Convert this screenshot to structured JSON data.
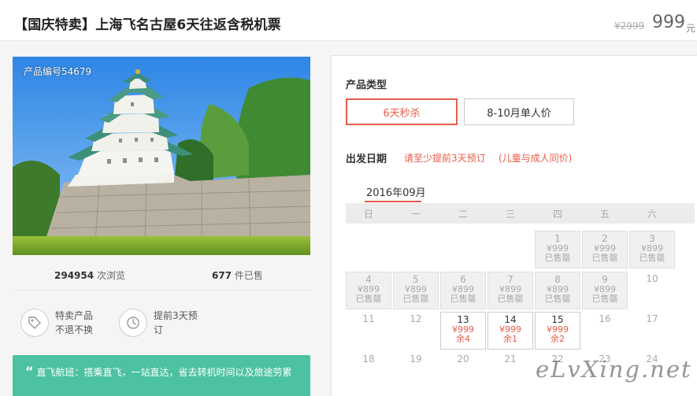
{
  "header": {
    "title": "【国庆特卖】上海飞名古屋6天往返含税机票",
    "old_price": "¥2999",
    "price": "999",
    "unit": "元"
  },
  "photo": {
    "product_no": "产品编号54679",
    "alt": "nagoya-castle-photo"
  },
  "stats": {
    "views_num": "294954",
    "views_label": "次浏览",
    "sold_num": "677",
    "sold_label": "件已售"
  },
  "features": [
    {
      "icon": "tag-icon",
      "line1": "特卖产品",
      "line2": "不退不换"
    },
    {
      "icon": "clock-icon",
      "line1": "提前3天预",
      "line2": "订"
    }
  ],
  "notice": {
    "quote": "“",
    "text": "直飞航班：搭乘直飞，一站直达，省去转机时间以及旅途劳累"
  },
  "booking": {
    "type_label": "产品类型",
    "types": [
      "6天秒杀",
      "8-10月单人价"
    ],
    "active_type": 0,
    "date_label": "出发日期",
    "note1": "请至少提前3天预订",
    "note2": "(儿童与成人同价)",
    "month": "2016年09月",
    "weekdays": [
      "日",
      "一",
      "二",
      "三",
      "四",
      "五",
      "六"
    ],
    "weeks": [
      [
        null,
        null,
        null,
        null,
        {
          "day": "1",
          "price": "¥999",
          "status": "已售罄",
          "state": "sold"
        },
        {
          "day": "2",
          "price": "¥999",
          "status": "已售罄",
          "state": "sold"
        },
        {
          "day": "3",
          "price": "¥899",
          "status": "已售罄",
          "state": "sold"
        }
      ],
      [
        {
          "day": "4",
          "price": "¥899",
          "status": "已售罄",
          "state": "sold"
        },
        {
          "day": "5",
          "price": "¥899",
          "status": "已售罄",
          "state": "sold"
        },
        {
          "day": "6",
          "price": "¥899",
          "status": "已售罄",
          "state": "sold"
        },
        {
          "day": "7",
          "price": "¥899",
          "status": "已售罄",
          "state": "sold"
        },
        {
          "day": "8",
          "price": "¥899",
          "status": "已售罄",
          "state": "sold"
        },
        {
          "day": "9",
          "price": "¥899",
          "status": "已售罄",
          "state": "sold"
        },
        {
          "day": "10",
          "state": "plain"
        }
      ],
      [
        {
          "day": "11",
          "state": "plain"
        },
        {
          "day": "12",
          "state": "plain"
        },
        {
          "day": "13",
          "price": "¥999",
          "status": "余4",
          "state": "sale"
        },
        {
          "day": "14",
          "price": "¥999",
          "status": "余1",
          "state": "sale"
        },
        {
          "day": "15",
          "price": "¥999",
          "status": "余2",
          "state": "sale"
        },
        {
          "day": "16",
          "state": "plain"
        },
        {
          "day": "17",
          "state": "plain"
        }
      ],
      [
        {
          "day": "18",
          "state": "plain"
        },
        {
          "day": "19",
          "state": "plain"
        },
        {
          "day": "20",
          "state": "plain"
        },
        {
          "day": "21",
          "state": "plain"
        },
        {
          "day": "22",
          "state": "plain"
        },
        {
          "day": "23",
          "state": "plain"
        },
        {
          "day": "24",
          "state": "plain"
        }
      ]
    ]
  },
  "watermark": "eLvXing.net",
  "colors": {
    "accent": "#e85c4a",
    "notice_bg": "#4dc2a2"
  }
}
